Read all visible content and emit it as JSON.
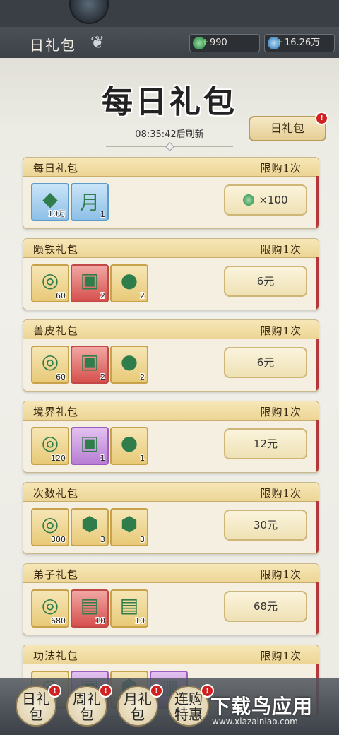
{
  "header": {
    "title": "日礼包",
    "currency_jade": "990",
    "currency_spirit": "16.26万"
  },
  "hero": {
    "title": "每日礼包",
    "refresh_text": "08:35:42后刷新",
    "tab_button": "日礼包"
  },
  "packs": [
    {
      "name": "每日礼包",
      "limit": "限购1次",
      "price": "×100",
      "price_icon": "jade-icon",
      "items": [
        {
          "icon": "crystal-icon",
          "qty": "10万",
          "style": "blue",
          "glyph": "◆"
        },
        {
          "icon": "moon-orb-icon",
          "qty": "1",
          "style": "blue",
          "glyph": "月"
        }
      ]
    },
    {
      "name": "陨铁礼包",
      "limit": "限购1次",
      "price": "6元",
      "items": [
        {
          "icon": "jade-icon",
          "qty": "60",
          "style": "gold",
          "glyph": "◎"
        },
        {
          "icon": "chest-icon",
          "qty": "2",
          "style": "red",
          "glyph": "▣"
        },
        {
          "icon": "pouch-icon",
          "qty": "2",
          "style": "gold",
          "glyph": "●"
        }
      ]
    },
    {
      "name": "兽皮礼包",
      "limit": "限购1次",
      "price": "6元",
      "items": [
        {
          "icon": "jade-icon",
          "qty": "60",
          "style": "gold",
          "glyph": "◎"
        },
        {
          "icon": "chest-icon",
          "qty": "2",
          "style": "red",
          "glyph": "▣"
        },
        {
          "icon": "pouch-icon",
          "qty": "2",
          "style": "gold",
          "glyph": "●"
        }
      ]
    },
    {
      "name": "境界礼包",
      "limit": "限购1次",
      "price": "12元",
      "items": [
        {
          "icon": "jade-icon",
          "qty": "120",
          "style": "gold",
          "glyph": "◎"
        },
        {
          "icon": "chest-icon",
          "qty": "1",
          "style": "purple",
          "glyph": "▣"
        },
        {
          "icon": "pouch-icon",
          "qty": "1",
          "style": "gold",
          "glyph": "●"
        }
      ]
    },
    {
      "name": "次数礼包",
      "limit": "限购1次",
      "price": "30元",
      "items": [
        {
          "icon": "jade-icon",
          "qty": "300",
          "style": "gold",
          "glyph": "◎"
        },
        {
          "icon": "token-icon",
          "qty": "3",
          "style": "gold",
          "glyph": "⬢"
        },
        {
          "icon": "token-green-icon",
          "qty": "3",
          "style": "gold",
          "glyph": "⬢"
        }
      ]
    },
    {
      "name": "弟子礼包",
      "limit": "限购1次",
      "price": "68元",
      "items": [
        {
          "icon": "jade-icon",
          "qty": "680",
          "style": "gold",
          "glyph": "◎"
        },
        {
          "icon": "scroll-red-icon",
          "qty": "10",
          "style": "red",
          "glyph": "▤"
        },
        {
          "icon": "scroll-icon",
          "qty": "10",
          "style": "gold",
          "glyph": "▤"
        }
      ]
    },
    {
      "name": "功法礼包",
      "limit": "限购1次",
      "price": "",
      "items": [
        {
          "icon": "jade-icon",
          "qty": "",
          "style": "gold",
          "glyph": "◎"
        },
        {
          "icon": "chest-icon",
          "qty": "",
          "style": "purple",
          "glyph": "▣"
        },
        {
          "icon": "token-icon",
          "qty": "",
          "style": "gold",
          "glyph": "⬢"
        },
        {
          "icon": "book-icon",
          "qty": "",
          "style": "purple",
          "glyph": "▥"
        }
      ]
    }
  ],
  "nav": [
    {
      "line1": "日礼",
      "line2": "包",
      "badge": "!"
    },
    {
      "line1": "周礼",
      "line2": "包",
      "badge": "!"
    },
    {
      "line1": "月礼",
      "line2": "包",
      "badge": "!"
    },
    {
      "line1": "连购",
      "line2": "特惠",
      "badge": "!"
    }
  ],
  "watermark": {
    "title": "下载鸟应用",
    "url": "www.xiazainiao.com"
  },
  "colors": {
    "card_bg": "#f4efe0",
    "cap_gold": "#ecd595",
    "red_bar": "#b3373b",
    "badge_red": "#d21f1f"
  }
}
